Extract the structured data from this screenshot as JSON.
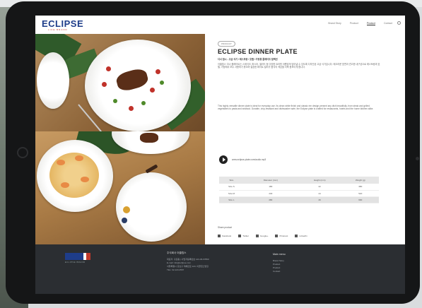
{
  "header": {
    "logo": "ECLIPSE",
    "logo_sub": "LIFE BRAND",
    "nav": [
      "Brand Story",
      "Product",
      "Product",
      "Contact"
    ]
  },
  "product": {
    "category_tag": "PRODUCT",
    "title": "ECLIPSE DINNER PLATE",
    "korean_lead": "디너 접시 - 고급 식기 / 레스토랑 / 호텔 / 가정용 플레이트 컬렉션",
    "desc_korean": "이클립스 디너 플레이트는 스테이크, 파스타, 샐러드 등 다양한 요리를 아름답게 담아낼 수 있도록 디자인된 고급 식기입니다. 매끄러운 표면과 견고한 내구성으로 레스토랑과 호텔, 가정에서 모두 사용하기 좋으며 깔끔한 화이트 컬러가 음식의 색감을 더욱 돋보이게 합니다.",
    "desc_english": "This highly versatile dinner plate is ideal for everyday use. Its clean white finish and classic rim design present any dish beautifully, from steak and grilled vegetables to pasta and seafood. Durable, chip-resistant and dishwasher safe, the Eclipse plate is crafted for restaurants, hotels and the home kitchen alike.",
    "audio_label": "www.eclipse-plate.com/audio.mp3"
  },
  "table": {
    "headers": [
      "Size",
      "Diameter (mm)",
      "Height (mm)",
      "Weight (g)"
    ],
    "rows": [
      [
        "Size S",
        "180",
        "22",
        "380"
      ],
      [
        "Size M",
        "230",
        "24",
        "520"
      ],
      [
        "Size L",
        "280",
        "26",
        "690"
      ]
    ]
  },
  "share": {
    "label": "Share product",
    "items": [
      "Facebook",
      "Twitter",
      "Google+",
      "Pinterest",
      "LinkedIn"
    ]
  },
  "footer": {
    "logo_sub": "ECLIPSE BRAND",
    "col1_title": "주식회사 이클립스",
    "col1_lines": [
      "대표자: 홍길동 | 사업자등록번호 123-45-67890",
      "E-mail: info@eclipse.com",
      "서울특별시 강남구 테헤란로 123, 이클립스빌딩",
      "TEL: 02-123-4567"
    ],
    "col2_title": "Main menu",
    "col2_lines": [
      "Brand Story",
      "Product",
      "Product",
      "Contact"
    ]
  }
}
